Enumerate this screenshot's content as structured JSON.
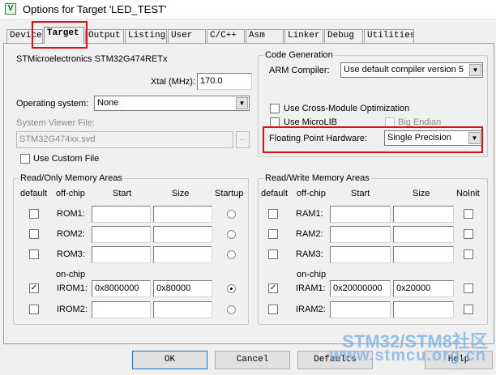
{
  "window": {
    "title": "Options for Target 'LED_TEST'",
    "icon_text": "V"
  },
  "tabs": [
    "Device",
    "Target",
    "Output",
    "Listing",
    "User",
    "C/C++",
    "Asm",
    "Linker",
    "Debug",
    "Utilities"
  ],
  "target": {
    "device_name": "STMicroelectronics STM32G474RETx",
    "xtal_label": "Xtal (MHz):",
    "xtal_value": "170.0",
    "os_label": "Operating system:",
    "os_value": "None",
    "svf_label": "System Viewer File:",
    "svf_value": "STM32G474xx.svd",
    "browse_label": "...",
    "custom_file_label": "Use Custom File"
  },
  "codegen": {
    "title": "Code Generation",
    "compiler_label": "ARM Compiler:",
    "compiler_value": "Use default compiler version 5",
    "cross_module_label": "Use Cross-Module Optimization",
    "microlib_label": "Use MicroLIB",
    "big_endian_label": "Big Endian",
    "fph_label": "Floating Point Hardware:",
    "fph_value": "Single Precision"
  },
  "rom": {
    "title": "Read/Only Memory Areas",
    "headers": {
      "default": "default",
      "offchip": "off-chip",
      "start": "Start",
      "size": "Size",
      "startup": "Startup"
    },
    "onchip_label": "on-chip",
    "rows": [
      {
        "name": "ROM1:",
        "start": "",
        "size": "",
        "default": false,
        "startup": false
      },
      {
        "name": "ROM2:",
        "start": "",
        "size": "",
        "default": false,
        "startup": false
      },
      {
        "name": "ROM3:",
        "start": "",
        "size": "",
        "default": false,
        "startup": false
      },
      {
        "name": "IROM1:",
        "start": "0x8000000",
        "size": "0x80000",
        "default": true,
        "startup": true
      },
      {
        "name": "IROM2:",
        "start": "",
        "size": "",
        "default": false,
        "startup": false
      }
    ]
  },
  "ram": {
    "title": "Read/Write Memory Areas",
    "headers": {
      "default": "default",
      "offchip": "off-chip",
      "start": "Start",
      "size": "Size",
      "noinit": "NoInit"
    },
    "onchip_label": "on-chip",
    "rows": [
      {
        "name": "RAM1:",
        "start": "",
        "size": "",
        "default": false,
        "noinit": false
      },
      {
        "name": "RAM2:",
        "start": "",
        "size": "",
        "default": false,
        "noinit": false
      },
      {
        "name": "RAM3:",
        "start": "",
        "size": "",
        "default": false,
        "noinit": false
      },
      {
        "name": "IRAM1:",
        "start": "0x20000000",
        "size": "0x20000",
        "default": true,
        "noinit": false
      },
      {
        "name": "IRAM2:",
        "start": "",
        "size": "",
        "default": false,
        "noinit": false
      }
    ]
  },
  "buttons": {
    "ok": "OK",
    "cancel": "Cancel",
    "defaults": "Defaults",
    "help": "Help"
  },
  "watermark": {
    "line1": "STM32/STM8社区",
    "line2": "www.stmcu.org.cn"
  },
  "colors": {
    "highlight": "#e01010",
    "watermark": "#78afe1"
  }
}
